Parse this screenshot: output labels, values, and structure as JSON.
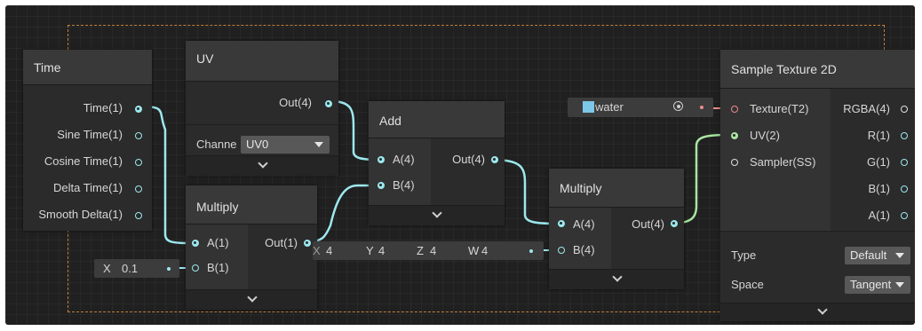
{
  "nodes": {
    "time": {
      "title": "Time",
      "outputs": [
        "Time(1)",
        "Sine Time(1)",
        "Cosine Time(1)",
        "Delta Time(1)",
        "Smooth Delta(1)"
      ]
    },
    "uv": {
      "title": "UV",
      "output": "Out(4)",
      "channel_label": "Channe",
      "channel_value": "UV0"
    },
    "multiply1": {
      "title": "Multiply",
      "inputs": [
        "A(1)",
        "B(1)"
      ],
      "output": "Out(1)"
    },
    "add": {
      "title": "Add",
      "inputs": [
        "A(4)",
        "B(4)"
      ],
      "output": "Out(4)"
    },
    "multiply2": {
      "title": "Multiply",
      "inputs": [
        "A(4)",
        "B(4)"
      ],
      "output": "Out(4)"
    },
    "sample_texture": {
      "title": "Sample Texture 2D",
      "inputs": [
        "Texture(T2)",
        "UV(2)",
        "Sampler(SS)"
      ],
      "outputs": [
        "RGBA(4)",
        "R(1)",
        "G(1)",
        "B(1)",
        "A(1)"
      ],
      "type_label": "Type",
      "type_value": "Default",
      "space_label": "Space",
      "space_value": "Tangent"
    }
  },
  "inline_inputs": {
    "x_label": "X",
    "x_value": "0.1",
    "vec4": {
      "x_label": "X",
      "x": "4",
      "y_label": "Y",
      "y": "4",
      "z_label": "Z",
      "z": "4",
      "w_label": "W",
      "w": "4"
    },
    "texture_name": "water"
  },
  "colors": {
    "background": "#202020",
    "node": "#2b2b2b",
    "header": "#393939",
    "vector_wire": "#9ce8ee",
    "float_wire": "#9ce8ee",
    "uv_wire": "#a8e6a0",
    "texture_wire": "#f08a8a",
    "group_border": "#c2803a"
  },
  "icons": [
    "chevron-down-icon",
    "dropdown-arrow-icon",
    "object-picker-icon",
    "texture-swatch-icon"
  ]
}
